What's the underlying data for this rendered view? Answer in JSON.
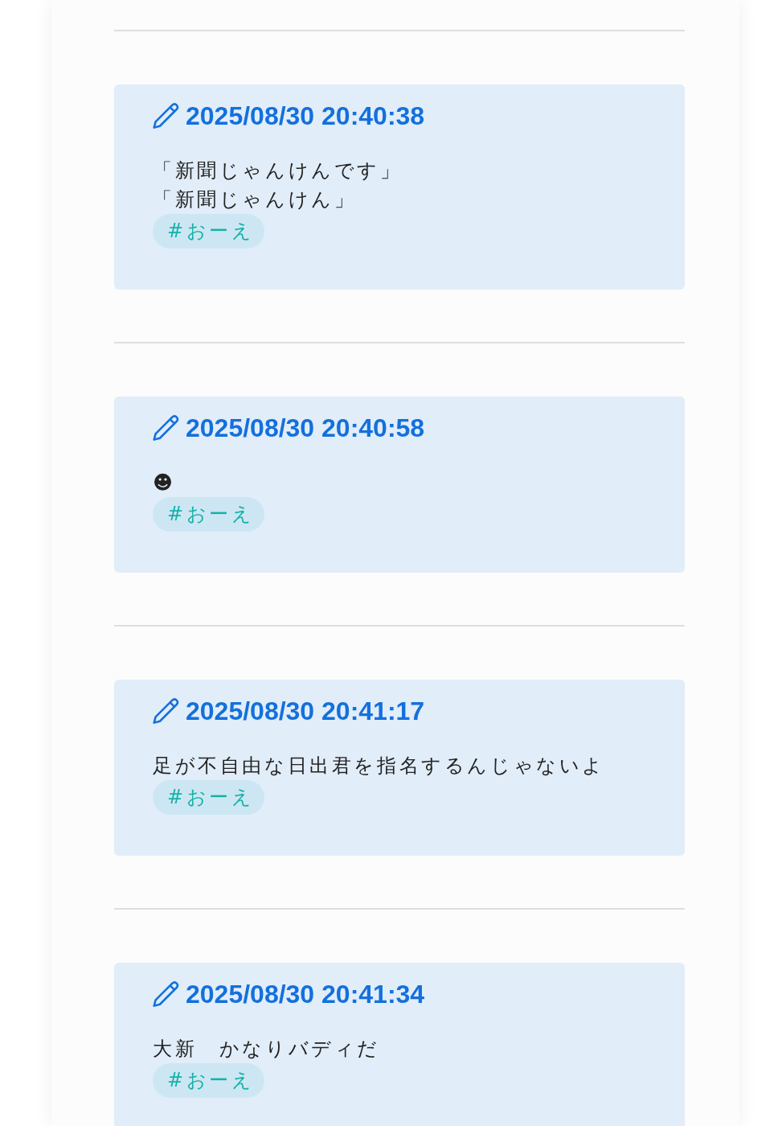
{
  "posts": [
    {
      "timestamp": "2025/08/30 20:40:38",
      "lines": [
        "「新聞じゃんけんです」",
        "「新聞じゃんけん」"
      ],
      "tags": [
        "#おーえ"
      ]
    },
    {
      "timestamp": "2025/08/30 20:40:58",
      "lines": [
        "☻"
      ],
      "tags": [
        "#おーえ"
      ]
    },
    {
      "timestamp": "2025/08/30 20:41:17",
      "lines": [
        "足が不自由な日出君を指名するんじゃないよ"
      ],
      "tags": [
        "#おーえ"
      ]
    },
    {
      "timestamp": "2025/08/30 20:41:34",
      "lines": [
        "大新　かなりバディだ"
      ],
      "tags": [
        "#おーえ"
      ]
    }
  ]
}
